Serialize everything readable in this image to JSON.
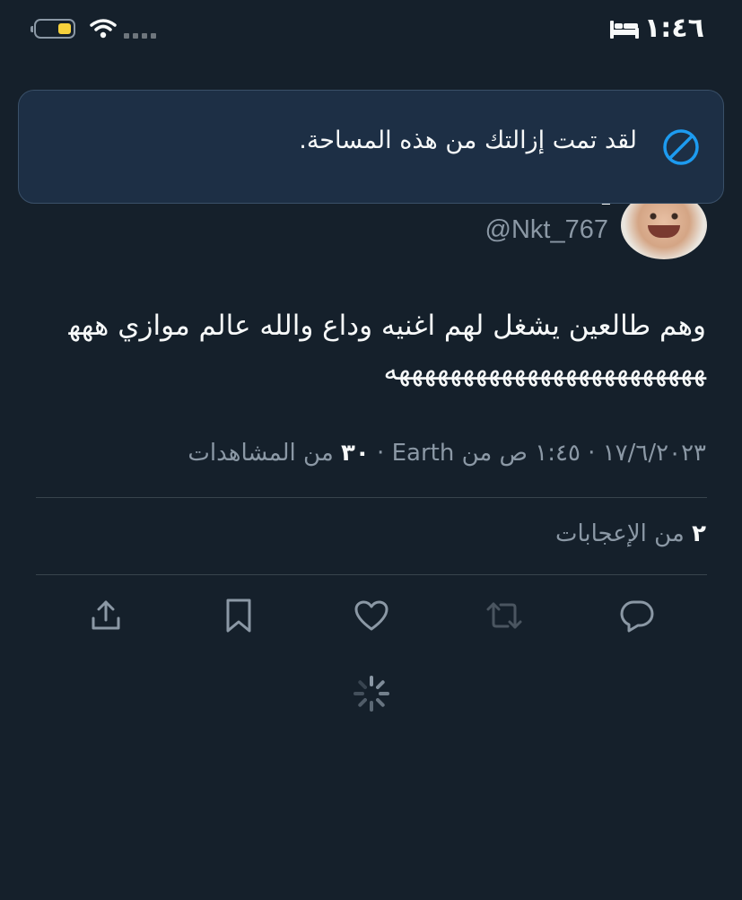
{
  "status_bar": {
    "time": "١:٤٦",
    "battery_level": 0.4
  },
  "toast": {
    "message": "لقد تمت إزالتك من هذه المساحة.",
    "icon": "block-icon"
  },
  "tweet": {
    "author_name_partial": "ـ",
    "handle": "@Nkt_767",
    "text": "وهم طالعين يشغل لهم اغنيه وداع والله عالم موازي هههههههههههههههههههههههههههه",
    "meta_prefix": "١٧/٦/٢٠٢٣ · ١:٤٥ ص من Earth · ",
    "views_count": "٣٠",
    "views_label": " من المشاهدات",
    "likes_count": "٢",
    "likes_label": " من الإعجابات"
  },
  "actions": [
    "reply-icon",
    "retweet-icon",
    "like-icon",
    "bookmark-icon",
    "share-icon"
  ],
  "colors": {
    "background": "#15202b",
    "toast_bg": "#1d2f45",
    "accent": "#1d9bf0",
    "muted": "#8b98a5"
  }
}
